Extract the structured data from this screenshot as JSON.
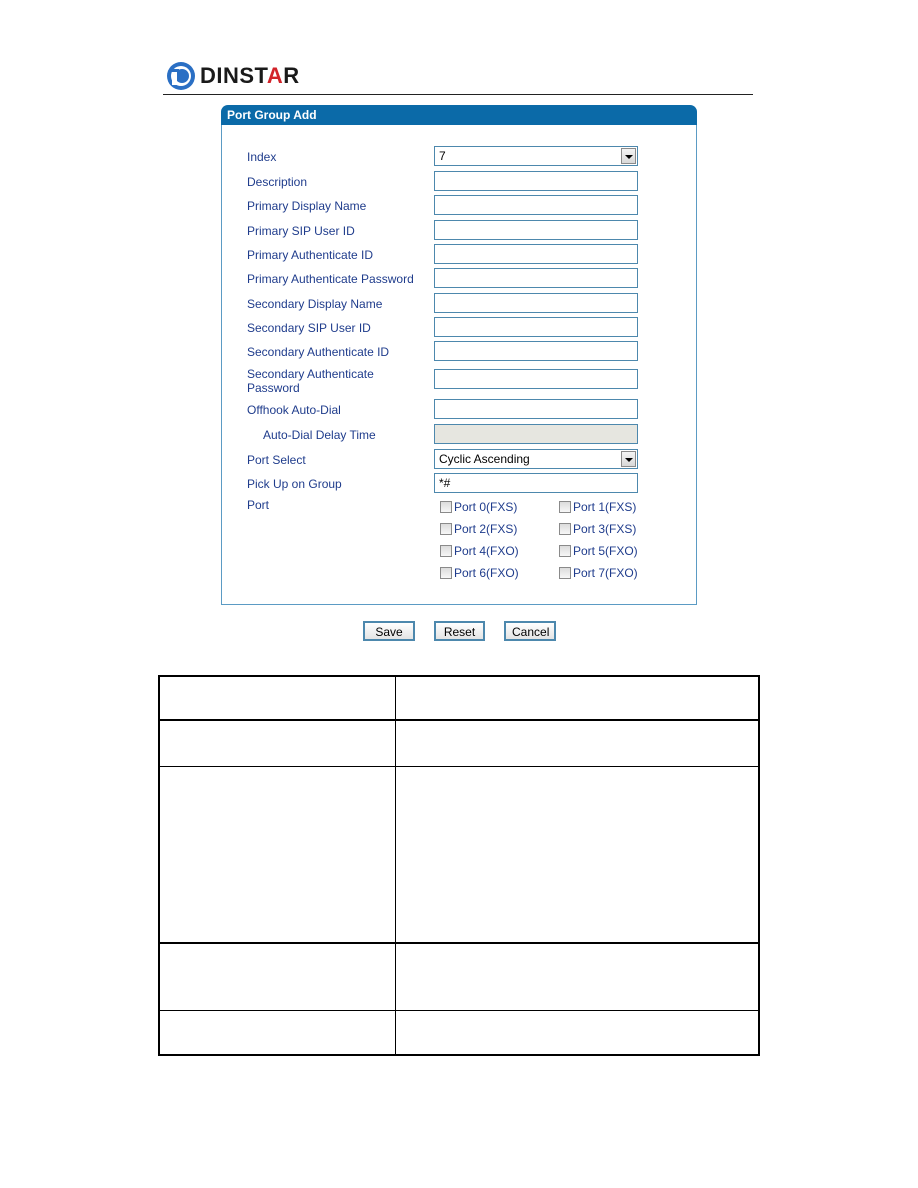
{
  "brand": {
    "name_prefix": "DINST",
    "name_accent": "A",
    "name_suffix": "R",
    "colors": {
      "primary": "#0b6aa8",
      "accent": "#d2232a"
    }
  },
  "panel": {
    "title": "Port Group Add",
    "fields": {
      "index": {
        "label": "Index",
        "value": "7"
      },
      "description": {
        "label": "Description",
        "value": ""
      },
      "primary_display_name": {
        "label": "Primary Display Name",
        "value": ""
      },
      "primary_sip_user_id": {
        "label": "Primary SIP User ID",
        "value": ""
      },
      "primary_authenticate_id": {
        "label": "Primary Authenticate ID",
        "value": ""
      },
      "primary_authenticate_password": {
        "label": "Primary Authenticate Password",
        "value": ""
      },
      "secondary_display_name": {
        "label": "Secondary Display Name",
        "value": ""
      },
      "secondary_sip_user_id": {
        "label": "Secondary SIP User ID",
        "value": ""
      },
      "secondary_authenticate_id": {
        "label": "Secondary Authenticate ID",
        "value": ""
      },
      "secondary_authenticate_password": {
        "label_line1": "Secondary Authenticate",
        "label_line2": "Password",
        "value": ""
      },
      "offhook_auto_dial": {
        "label": "Offhook Auto-Dial",
        "value": ""
      },
      "auto_dial_delay_time": {
        "label": "Auto-Dial Delay Time",
        "value": ""
      },
      "port_select": {
        "label": "Port Select",
        "value": "Cyclic Ascending"
      },
      "pick_up_on_group": {
        "label": "Pick Up on Group",
        "value": "*#"
      },
      "port": {
        "label": "Port"
      }
    },
    "ports": [
      {
        "label": "Port 0(FXS)",
        "checked": false
      },
      {
        "label": "Port 1(FXS)",
        "checked": false
      },
      {
        "label": "Port 2(FXS)",
        "checked": false
      },
      {
        "label": "Port 3(FXS)",
        "checked": false
      },
      {
        "label": "Port 4(FXO)",
        "checked": false
      },
      {
        "label": "Port 5(FXO)",
        "checked": false
      },
      {
        "label": "Port 6(FXO)",
        "checked": false
      },
      {
        "label": "Port 7(FXO)",
        "checked": false
      }
    ]
  },
  "buttons": {
    "save": "Save",
    "reset": "Reset",
    "cancel": "Cancel"
  },
  "table": {
    "rows": 5,
    "columns": 2
  }
}
